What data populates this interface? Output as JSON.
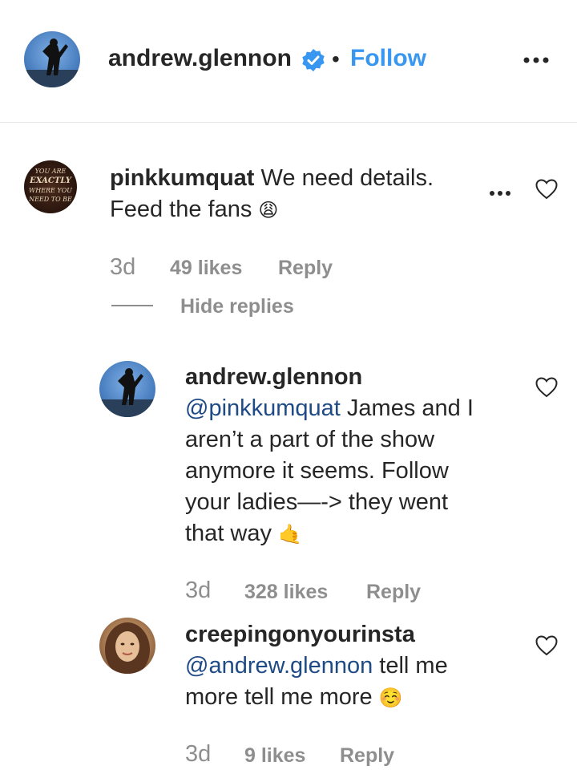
{
  "header": {
    "username": "andrew.glennon",
    "separator": "•",
    "follow_label": "Follow",
    "more_icon": "ellipsis-icon",
    "verified_icon": "verified-badge-icon",
    "accent": "#3897f0"
  },
  "comments": [
    {
      "username": "pinkkumquat",
      "avatar_text": [
        "YOU ARE",
        "EXACTLY",
        "WHERE YOU",
        "NEED TO BE"
      ],
      "text_line1": "We need details.",
      "text_line2": "Feed the fans",
      "emoji": "😩",
      "time": "3d",
      "likes": "49 likes",
      "reply_label": "Reply",
      "hide_replies": "Hide replies"
    }
  ],
  "replies": [
    {
      "username": "andrew.glennon",
      "mention": "@pinkkumquat",
      "text_after_mention": " James and I",
      "lines": [
        "aren’t a part of the show",
        "anymore it seems. Follow",
        "your ladies—-> they went",
        "that way"
      ],
      "emoji": "🤙",
      "time": "3d",
      "likes": "328 likes",
      "reply_label": "Reply"
    },
    {
      "username": "creepingonyourinsta",
      "mention": "@andrew.glennon",
      "text_after_mention": " tell me",
      "lines": [
        "more tell me more"
      ],
      "emoji": "☺️",
      "time": "3d",
      "likes": "9 likes",
      "reply_label": "Reply"
    }
  ]
}
